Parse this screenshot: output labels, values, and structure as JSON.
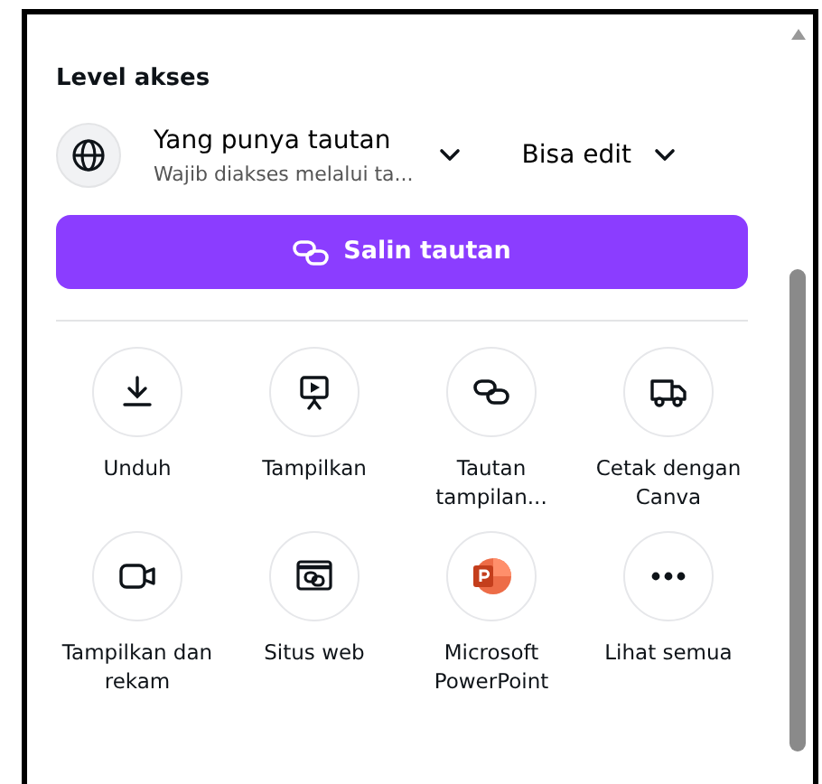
{
  "section_title": "Level akses",
  "access": {
    "title": "Yang punya tautan",
    "subtitle": "Wajib diakses melalui ta...",
    "permission": "Bisa edit"
  },
  "copy_button": "Salin tautan",
  "actions": [
    {
      "label": "Unduh",
      "kind": "download"
    },
    {
      "label": "Tampilkan",
      "kind": "present"
    },
    {
      "label": "Tautan tampilan...",
      "kind": "link"
    },
    {
      "label": "Cetak dengan Canva",
      "kind": "truck"
    },
    {
      "label": "Tampilkan dan rekam",
      "kind": "camera"
    },
    {
      "label": "Situs web",
      "kind": "website"
    },
    {
      "label": "Microsoft PowerPoint",
      "kind": "powerpoint"
    },
    {
      "label": "Lihat semua",
      "kind": "more"
    }
  ]
}
